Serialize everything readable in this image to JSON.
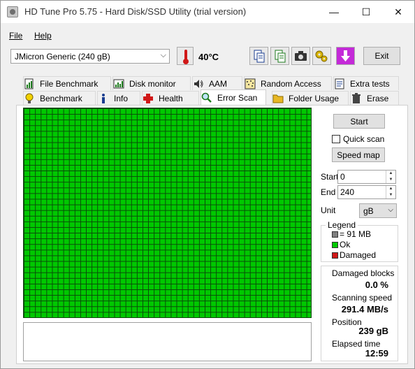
{
  "window": {
    "title": "HD Tune Pro 5.75 - Hard Disk/SSD Utility (trial version)",
    "minimize_glyph": "—",
    "maximize_glyph": "☐",
    "close_glyph": "✕"
  },
  "menu": {
    "file": "File",
    "help": "Help"
  },
  "toolbar": {
    "drive": "JMicron Generic (240 gB)",
    "temperature": "40°C",
    "exit_label": "Exit"
  },
  "tabs": {
    "row1": [
      "File Benchmark",
      "Disk monitor",
      "AAM",
      "Random Access",
      "Extra tests"
    ],
    "row2": [
      "Benchmark",
      "Info",
      "Health",
      "Error Scan",
      "Folder Usage",
      "Erase"
    ],
    "active": "Error Scan"
  },
  "error_scan": {
    "start_button": "Start",
    "quick_scan_label": "Quick scan",
    "quick_scan_checked": false,
    "speed_map_button": "Speed map",
    "start_label": "Start",
    "start_value": "0",
    "end_label": "End",
    "end_value": "240",
    "unit_label": "Unit",
    "unit_value": "gB",
    "legend": {
      "title": "Legend",
      "block_size": "= 91 MB",
      "ok": "Ok",
      "damaged": "Damaged",
      "colors": {
        "block": "#808080",
        "ok": "#00c800",
        "damaged": "#d01818"
      }
    },
    "stats": {
      "damaged_blocks_label": "Damaged blocks",
      "damaged_blocks_value": "0.0 %",
      "scanning_speed_label": "Scanning speed",
      "scanning_speed_value": "291.4 MB/s",
      "position_label": "Position",
      "position_value": "239 gB",
      "elapsed_label": "Elapsed time",
      "elapsed_value": "12:59"
    },
    "grid_status": "all blocks ok"
  }
}
